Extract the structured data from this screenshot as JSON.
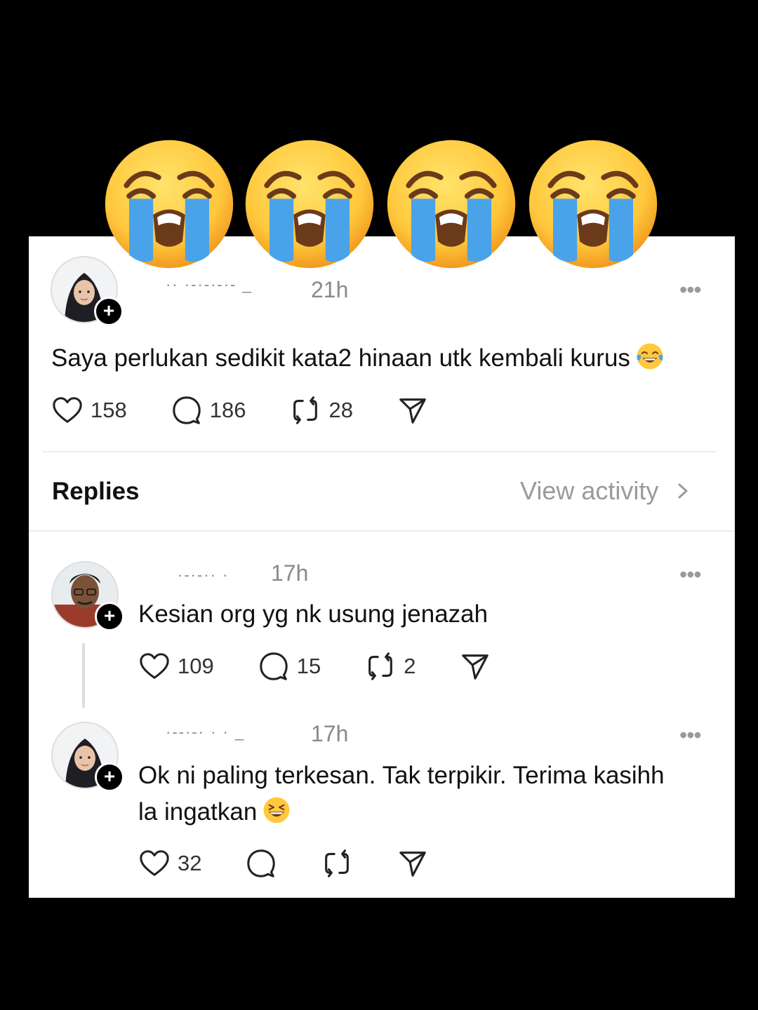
{
  "overlay_emojis": [
    "loudly-crying-face",
    "loudly-crying-face",
    "loudly-crying-face",
    "loudly-crying-face"
  ],
  "post": {
    "username": "·· ·-·-·-·- _",
    "time": "21h",
    "text": "Saya perlukan sedikit kata2 hinaan utk kembali kurus",
    "emoji": "face-with-tears-of-joy",
    "likes": "158",
    "comments": "186",
    "reposts": "28"
  },
  "replies_header": {
    "label": "Replies",
    "view_activity": "View activity"
  },
  "replies": [
    {
      "username": "·-·-·· ·",
      "time": "17h",
      "text": "Kesian org yg nk usung jenazah",
      "likes": "109",
      "comments": "15",
      "reposts": "2"
    },
    {
      "username": "·--·-· · · _",
      "time": "17h",
      "text_line1": "Ok ni paling terkesan. Tak terpikir. Terima kasihh",
      "text_line2": "la ingatkan",
      "emoji": "grinning-squinting-face",
      "likes": "32"
    }
  ],
  "colors": {
    "background": "#000000",
    "card": "#ffffff",
    "muted_text": "#8a8a8a",
    "emoji_yellow": "#FFC83D",
    "tear_blue": "#4AA3E8"
  }
}
